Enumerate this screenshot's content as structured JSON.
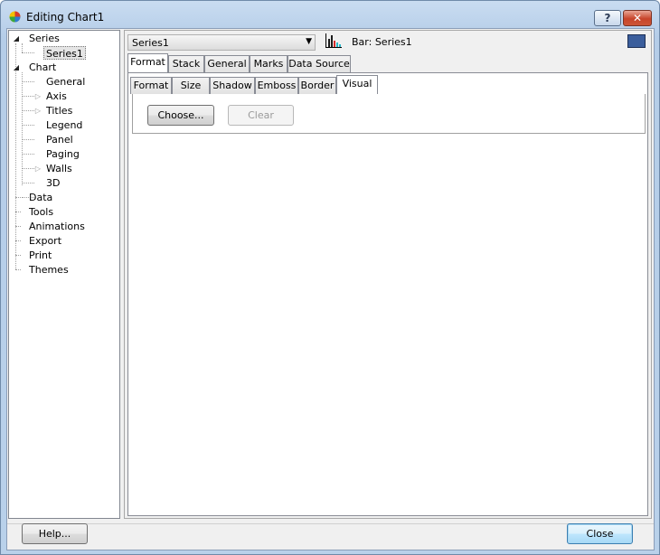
{
  "window": {
    "title": "Editing Chart1",
    "help_glyph": "?",
    "close_glyph": "✕"
  },
  "tree": {
    "series": "Series",
    "series1": "Series1",
    "chart": "Chart",
    "general": "General",
    "axis": "Axis",
    "titles": "Titles",
    "legend": "Legend",
    "panel": "Panel",
    "paging": "Paging",
    "walls": "Walls",
    "three_d": "3D",
    "data": "Data",
    "tools": "Tools",
    "animations": "Animations",
    "export": "Export",
    "print": "Print",
    "themes": "Themes"
  },
  "series_selector": {
    "value": "Series1",
    "arrow": "▼"
  },
  "series_type": "Bar: Series1",
  "series_color": "#3b5e9c",
  "main_tabs": [
    "Format",
    "Stack",
    "General",
    "Marks",
    "Data Source"
  ],
  "sub_tabs": [
    "Format",
    "Size",
    "Shadow",
    "Emboss",
    "Border",
    "Visual"
  ],
  "visual": {
    "choose_label": "Choose...",
    "clear_label": "Clear"
  },
  "footer": {
    "help_label": "Help...",
    "close_label": "Close"
  }
}
